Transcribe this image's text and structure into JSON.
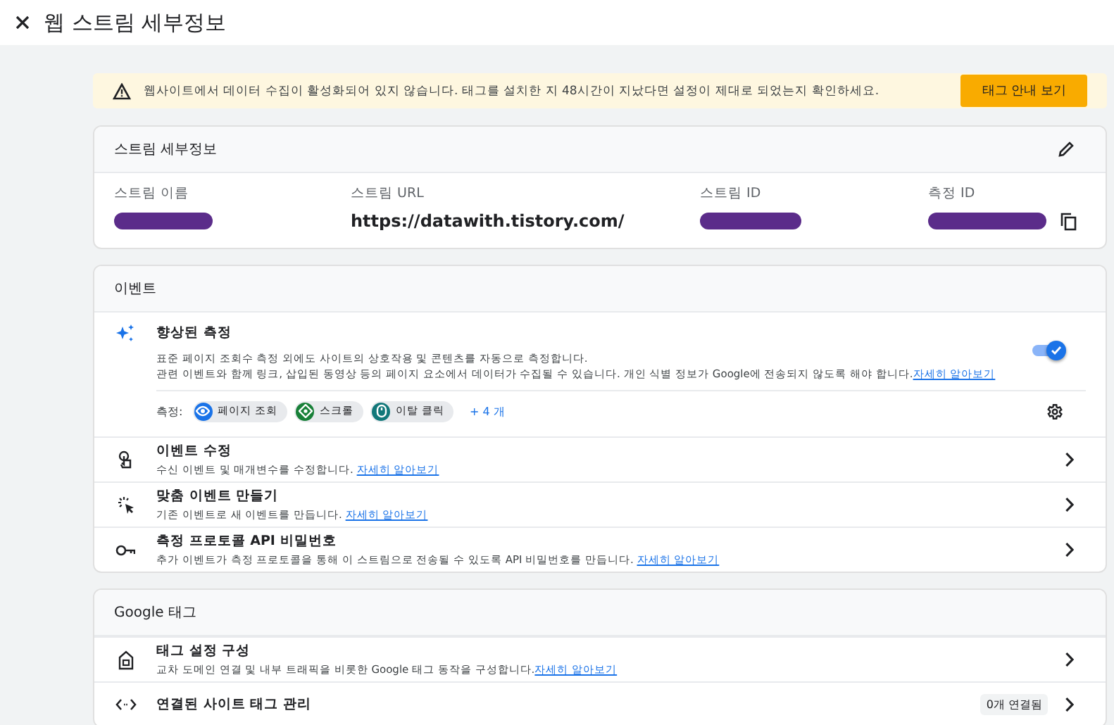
{
  "header": {
    "title": "웹 스트림 세부정보"
  },
  "banner": {
    "message": "웹사이트에서 데이터 수집이 활성화되어 있지 않습니다. 태그를 설치한 지 48시간이 지났다면 설정이 제대로 되었는지 확인하세요.",
    "button": "태그 안내 보기"
  },
  "stream_details": {
    "title": "스트림 세부정보",
    "fields": [
      {
        "label": "스트림 이름",
        "kind": "redacted"
      },
      {
        "label": "스트림 URL",
        "kind": "text",
        "value": "https://datawith.tistory.com/"
      },
      {
        "label": "스트림 ID",
        "kind": "redacted"
      },
      {
        "label": "측정 ID",
        "kind": "redacted"
      }
    ]
  },
  "events": {
    "title": "이벤트",
    "enhanced": {
      "title": "향상된 측정",
      "description": "표준 페이지 조회수 측정 외에도 사이트의 상호작용 및 콘텐츠를 자동으로 측정합니다.",
      "description_2": "관련 이벤트와 함께 링크, 삽입된 동영상 등의 페이지 요소에서 데이터가 수집될 수 있습니다. 개인 식별 정보가 Google에 전송되지 않도록 해야 합니다.",
      "link": "자세히 알아보기",
      "on": true,
      "measures_label": "측정:",
      "chips": [
        {
          "label": "페이지 조회",
          "color": "#1a73e8",
          "kind": "eye"
        },
        {
          "label": "스크롤",
          "color": "#188038",
          "kind": "scroll"
        },
        {
          "label": "이탈 클릭",
          "color": "#12787a",
          "kind": "mouse"
        }
      ],
      "more": "+ 4 개"
    },
    "rows": [
      {
        "kind": "touch",
        "title": "이벤트 수정",
        "description": "수신 이벤트 및 매개변수를 수정합니다.",
        "link": "자세히 알아보기"
      },
      {
        "kind": "sparkle",
        "title": "맞춤 이벤트 만들기",
        "description": "기존 이벤트로 새 이벤트를 만듭니다.",
        "link": "자세히 알아보기"
      },
      {
        "kind": "key",
        "title": "측정 프로토콜 API 비밀번호",
        "description": "추가 이벤트가 측정 프로토콜을 통해 이 스트림으로 전송될 수 있도록 API 비밀번호를 만듭니다.",
        "link": "자세히 알아보기"
      }
    ]
  },
  "google_tag": {
    "title": "Google 태그",
    "rows": [
      {
        "kind": "tag",
        "title": "태그 설정 구성",
        "description": "교차 도메인 연결 및 내부 트래픽을 비롯한 Google 태그 동작을 구성합니다.",
        "link": "자세히 알아보기"
      },
      {
        "kind": "code",
        "title": "연결된 사이트 태그 관리",
        "badge": "0개 연결됨"
      }
    ]
  }
}
